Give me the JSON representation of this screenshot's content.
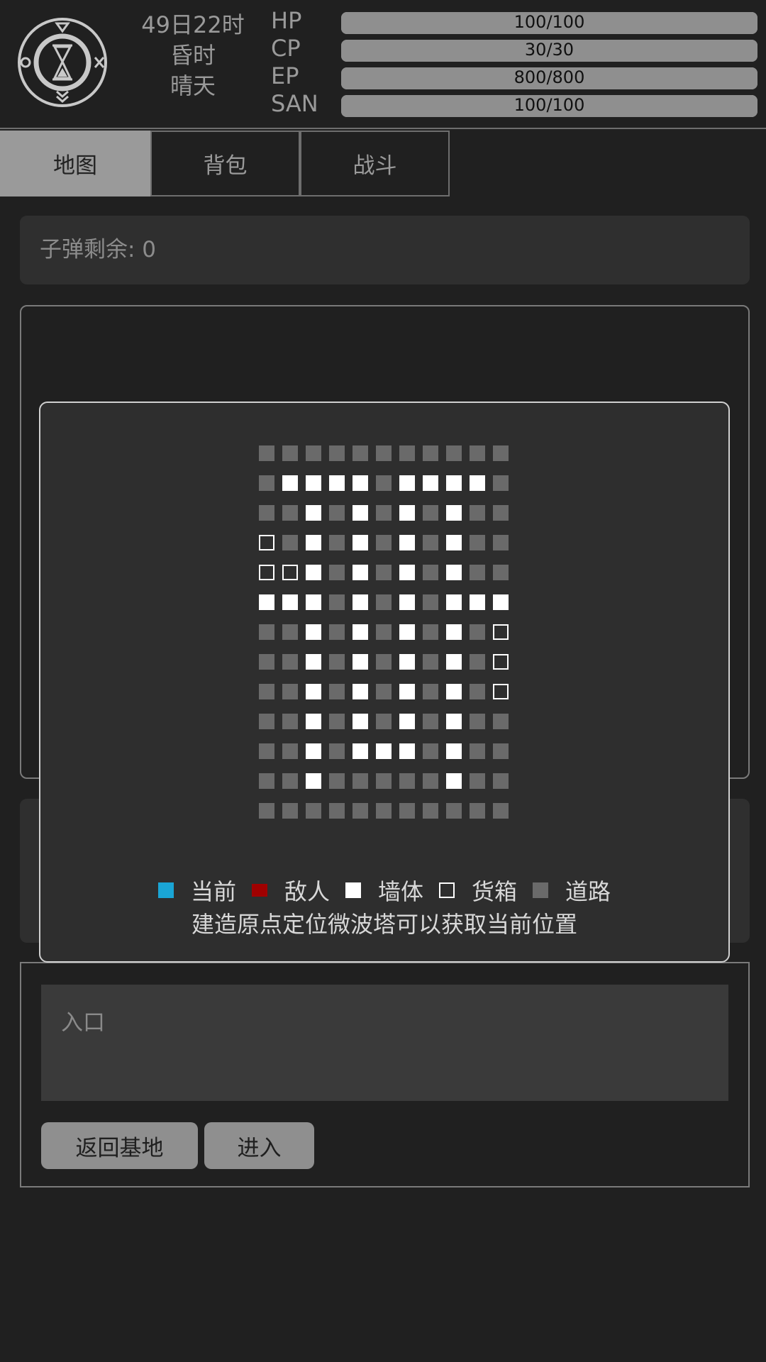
{
  "status": {
    "time": "49日22时",
    "period": "昏时",
    "weather": "晴天",
    "stats": [
      {
        "label": "HP",
        "text": "100/100",
        "fraction": 1.0
      },
      {
        "label": "CP",
        "text": "30/30",
        "fraction": 1.0
      },
      {
        "label": "EP",
        "text": "800/800",
        "fraction": 1.0
      },
      {
        "label": "SAN",
        "text": "100/100",
        "fraction": 1.0
      }
    ]
  },
  "tabs": [
    {
      "label": "地图",
      "active": true
    },
    {
      "label": "背包",
      "active": false
    },
    {
      "label": "战斗",
      "active": false
    }
  ],
  "ammo": {
    "text": "子弹剩余: 0"
  },
  "map": {
    "grid": [
      "rrrrrrrrrrr",
      "rwwwwrwwwwr",
      "rrwrwrwrwrr",
      "crwrwrwrwrr",
      "ccwrwrwrwrr",
      "wwwrwrwrwww",
      "rrwrwrwrwrc",
      "rrwrwrwrwrc",
      "rrwrwrwrwrc",
      "rrwrwrwrwrr",
      "rrwrwwwrwrr",
      "rrwrrrrrwrr",
      "rrrrrrrrrrr"
    ],
    "legend": [
      {
        "key": "current",
        "label": "当前",
        "color": "#1aa5d5"
      },
      {
        "key": "enemy",
        "label": "敌人",
        "color": "#a00000"
      },
      {
        "key": "wall",
        "label": "墙体",
        "color": "#ffffff"
      },
      {
        "key": "crate",
        "label": "货箱",
        "color": "#ffffff"
      },
      {
        "key": "road",
        "label": "道路",
        "color": "#6a6a6a"
      }
    ],
    "hint": "建造原点定位微波塔可以获取当前位置"
  },
  "entry": {
    "title": "入口",
    "return_label": "返回基地",
    "enter_label": "进入"
  }
}
